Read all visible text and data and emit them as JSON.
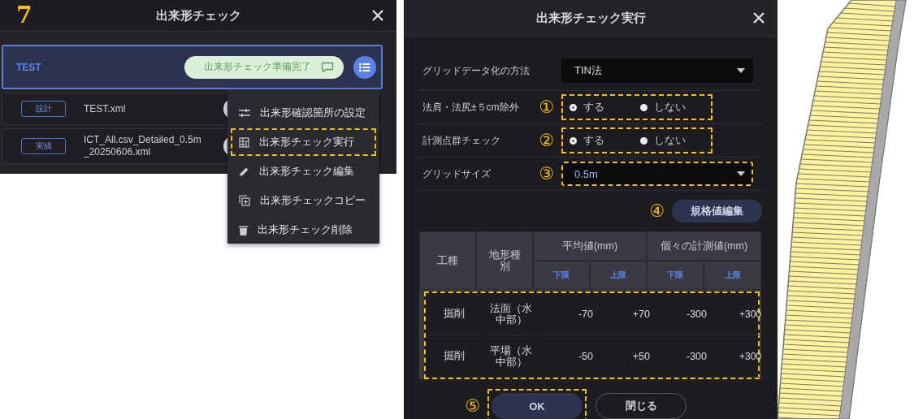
{
  "step_number": "7",
  "check_panel": {
    "title": "出来形チェック",
    "selected_item": {
      "name": "TEST",
      "status": "出来形チェック準備完了",
      "selected": true
    },
    "files": [
      {
        "tag": "設計",
        "name": "TEST.xml"
      },
      {
        "tag": "実績",
        "name": "ICT_All.csv_Detailed_0.5m_20250606.xml"
      }
    ]
  },
  "context_menu": {
    "items": [
      {
        "kind": "settings",
        "label": "出来形確認箇所の設定",
        "highlighted": false
      },
      {
        "kind": "run",
        "label": "出来形チェック実行",
        "highlighted": true
      },
      {
        "kind": "edit",
        "label": "出来形チェック編集",
        "highlighted": false
      },
      {
        "kind": "copy",
        "label": "出来形チェックコピー",
        "highlighted": false
      },
      {
        "kind": "delete",
        "label": "出来形チェック削除",
        "highlighted": false
      }
    ]
  },
  "exec_dialog": {
    "title": "出来形チェック実行",
    "rows": [
      {
        "kind": "select",
        "label": "グリッドデータ化の方法",
        "value": "TIN法",
        "highlighted": false
      },
      {
        "kind": "radio",
        "label": "法肩・法尻±５cm除外",
        "marker": "①",
        "highlighted": true,
        "options": [
          {
            "label": "する",
            "selected": true
          },
          {
            "label": "しない",
            "selected": false
          }
        ]
      },
      {
        "kind": "radio",
        "label": "計測点群チェック",
        "marker": "②",
        "highlighted": true,
        "options": [
          {
            "label": "する",
            "selected": true
          },
          {
            "label": "しない",
            "selected": false
          }
        ]
      },
      {
        "kind": "select",
        "label": "グリッドサイズ",
        "marker": "③",
        "value": "0.5m",
        "highlighted": true
      }
    ],
    "edit_button": {
      "marker": "④",
      "label": "規格値編集"
    },
    "table": {
      "highlighted": true,
      "columns": {
        "work_type": "工種",
        "terrain_type": "地形種別",
        "average": "平均値(mm)",
        "individual": "個々の計測値(mm)",
        "sub_columns": [
          "下限",
          "上限",
          "下限",
          "上限"
        ]
      },
      "rows": [
        {
          "work_type": "掘削",
          "terrain_type": "法面（水中部）",
          "average_lower": "-70",
          "average_upper": "+70",
          "individual_lower": "-300",
          "individual_upper": "+300"
        },
        {
          "work_type": "掘削",
          "terrain_type": "平場（水中部）",
          "average_lower": "-50",
          "average_upper": "+50",
          "individual_lower": "-300",
          "individual_upper": "+300"
        }
      ]
    },
    "buttons": [
      {
        "kind": "primary",
        "label": "OK",
        "marker": "⑤",
        "highlighted": true
      },
      {
        "kind": "secondary",
        "label": "閉じる",
        "highlighted": false
      }
    ]
  }
}
